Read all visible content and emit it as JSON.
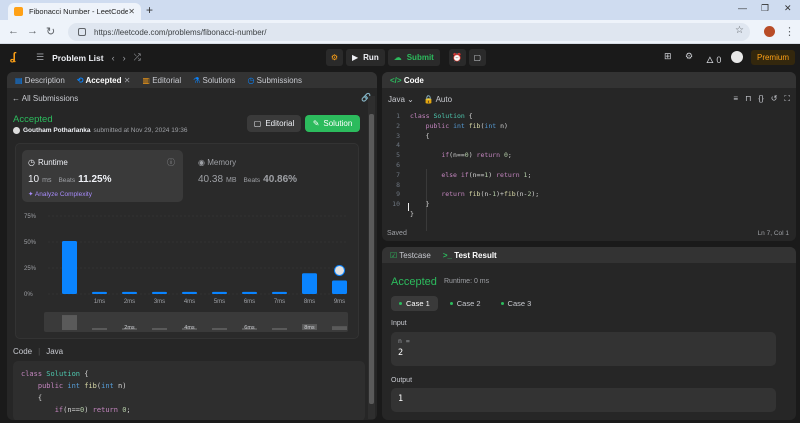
{
  "browser": {
    "tab_title": "Fibonacci Number - LeetCode",
    "url": "https://leetcode.com/problems/fibonacci-number/"
  },
  "topbar": {
    "problem_list": "Problem List",
    "run": "Run",
    "submit": "Submit",
    "streak": "0",
    "premium": "Premium"
  },
  "left": {
    "tabs": [
      "Description",
      "Accepted",
      "Editorial",
      "Solutions",
      "Submissions"
    ],
    "all_submissions": "All Submissions",
    "status": "Accepted",
    "user": "Goutham Potharlanka",
    "submitted_at": "submitted at Nov 29, 2024 19:36",
    "editorial_btn": "Editorial",
    "solution_btn": "Solution",
    "runtime": {
      "label": "Runtime",
      "value": "10",
      "unit": "ms",
      "beats_label": "Beats",
      "beats": "11.25%",
      "analyze": "Analyze Complexity"
    },
    "memory": {
      "label": "Memory",
      "value": "40.38",
      "unit": "MB",
      "beats_label": "Beats",
      "beats": "40.86%"
    },
    "code_label": "Code",
    "code_lang": "Java",
    "code_lines": [
      "class Solution {",
      "    public int fib(int n)",
      "    {",
      "        if(n==0) return 0;"
    ]
  },
  "chart_data": {
    "type": "bar",
    "categories": [
      "",
      "1ms",
      "2ms",
      "3ms",
      "4ms",
      "5ms",
      "6ms",
      "7ms",
      "8ms",
      "9ms"
    ],
    "values": [
      51,
      2,
      2,
      2,
      2,
      2,
      2,
      2,
      20,
      13
    ],
    "yticks": [
      "75%",
      "50%",
      "25%",
      "0%"
    ],
    "ylim": [
      0,
      75
    ],
    "highlight_index": 9,
    "colors": {
      "bar": "#0a84ff",
      "highlight": "#0a84ff"
    },
    "minimap_labels": [
      "",
      "",
      "2ms",
      "",
      "4ms",
      "",
      "6ms",
      "",
      "8ms",
      ""
    ]
  },
  "code_panel": {
    "title": "Code",
    "language": "Java",
    "mode": "Auto",
    "lines": [
      "class Solution {",
      "    public int fib(int n)",
      "    {",
      "",
      "        if(n==0) return 0;",
      "",
      "        else if(n==1) return 1;",
      "",
      "        return fib(n-1)+fib(n-2);",
      "    }",
      "}"
    ],
    "line_numbers": [
      "1",
      "2",
      "3",
      "4",
      "5",
      "6",
      "7",
      "8",
      "9",
      "10"
    ],
    "saved": "Saved",
    "cursor": "Ln 7, Col 1"
  },
  "test_panel": {
    "tab_testcase": "Testcase",
    "tab_result": "Test Result",
    "status": "Accepted",
    "runtime": "Runtime: 0 ms",
    "cases": [
      "Case 1",
      "Case 2",
      "Case 3"
    ],
    "input_label": "Input",
    "input_name": "n =",
    "input_value": "2",
    "output_label": "Output",
    "output_value": "1"
  }
}
